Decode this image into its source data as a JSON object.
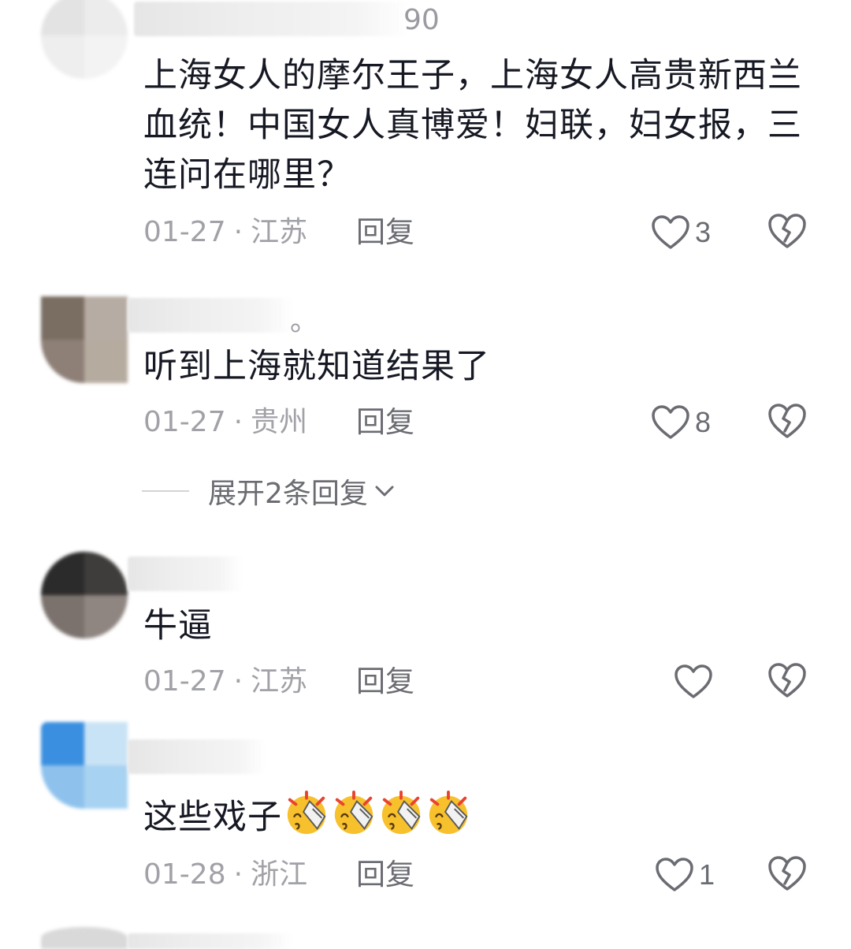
{
  "comments": [
    {
      "username_tail": "90",
      "text": "上海女人的摩尔王子，上海女人高贵新西兰血统！中国女人真博爱！妇联，妇女报，三连问在哪里？",
      "date": "01-27",
      "location": "江苏",
      "reply_label": "回复",
      "likes": "3"
    },
    {
      "username_tail": "。",
      "text": "听到上海就知道结果了",
      "date": "01-27",
      "location": "贵州",
      "reply_label": "回复",
      "likes": "8",
      "expand_label": "展开2条回复"
    },
    {
      "username_tail": "",
      "text": "牛逼",
      "date": "01-27",
      "location": "江苏",
      "reply_label": "回复",
      "likes": ""
    },
    {
      "username_tail": "",
      "text": "这些戏子",
      "emoji": "facepalm-emoji",
      "emoji_count": 4,
      "date": "01-28",
      "location": "浙江",
      "reply_label": "回复",
      "likes": "1"
    }
  ],
  "meta_separator": "·",
  "colors": {
    "text": "#161823",
    "meta": "#a1a2a7",
    "icon": "#6b6c72"
  }
}
